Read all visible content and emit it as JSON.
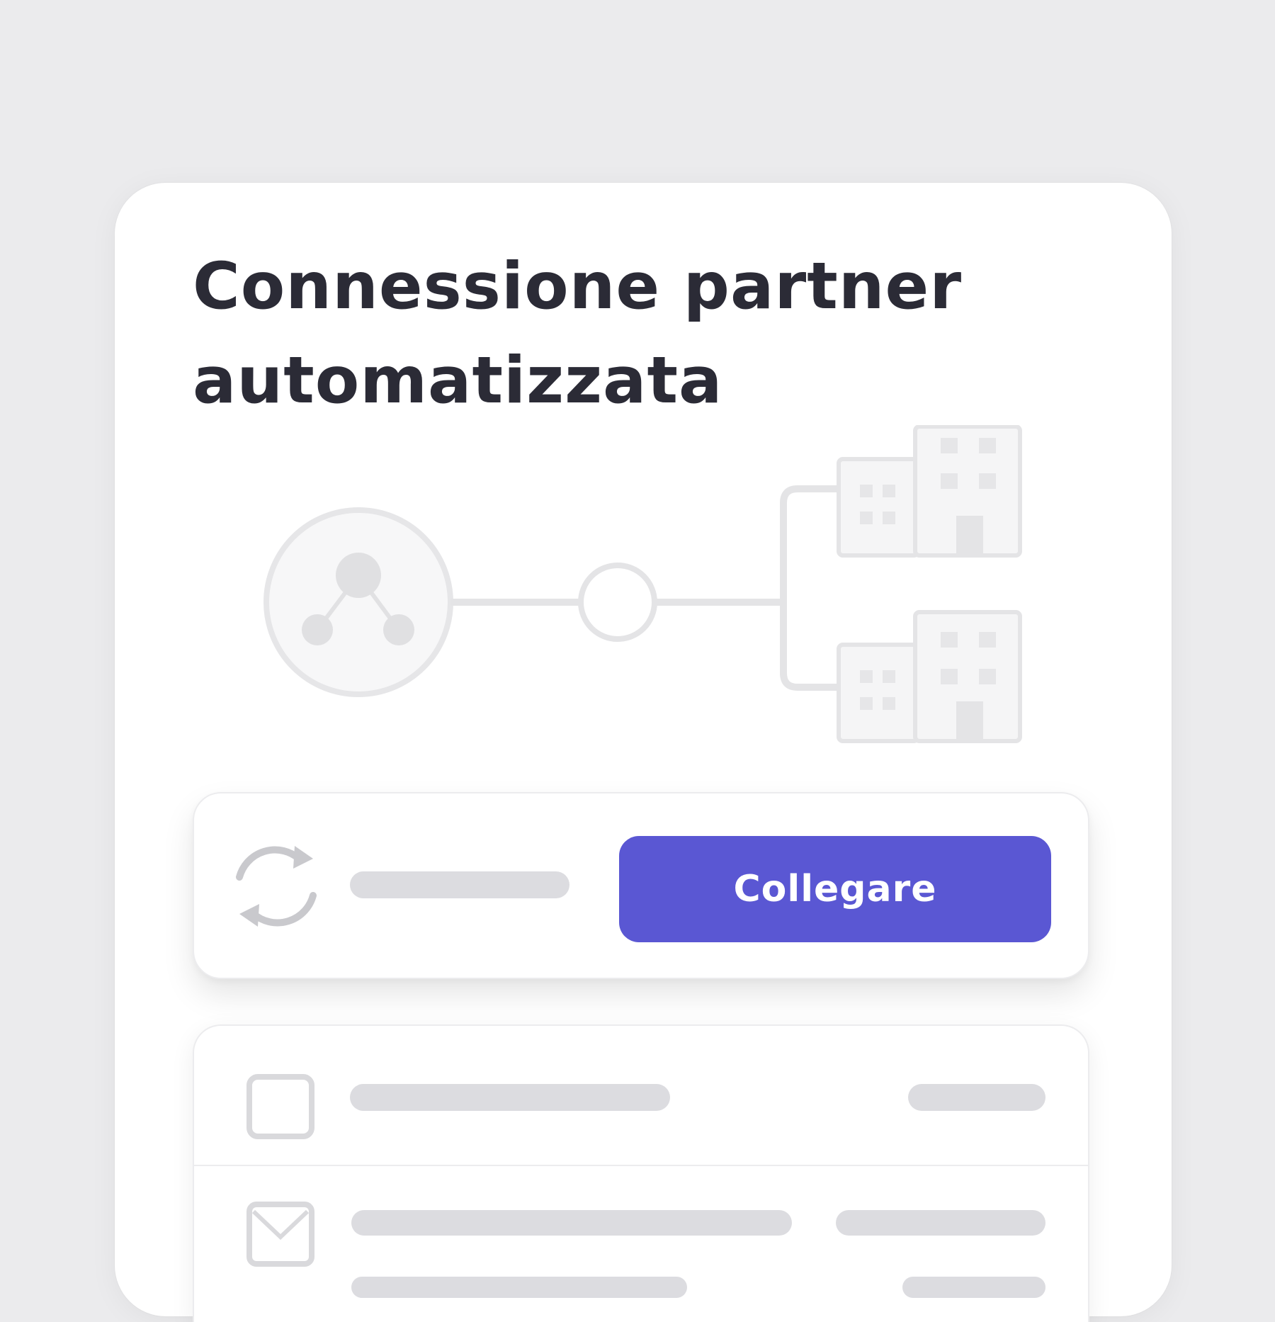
{
  "page": {
    "title": "Connessione partner automatizzata"
  },
  "illustration": {
    "hub_icon": "network-hub-icon",
    "node_icon": "empty-node-icon",
    "partner_icons": [
      "office-building-icon",
      "office-building-icon"
    ]
  },
  "connect_panel": {
    "icon": "sync-icon",
    "button_label": "Collegare"
  },
  "list": {
    "rows": [
      {
        "icon": "checkbox-icon"
      },
      {
        "icon": "mail-icon"
      }
    ]
  },
  "colors": {
    "background": "#ebebed",
    "card": "#ffffff",
    "title_text": "#2b2b36",
    "accent": "#5a57d3",
    "placeholder": "#dcdce0",
    "line_art": "#e4e4e6"
  }
}
